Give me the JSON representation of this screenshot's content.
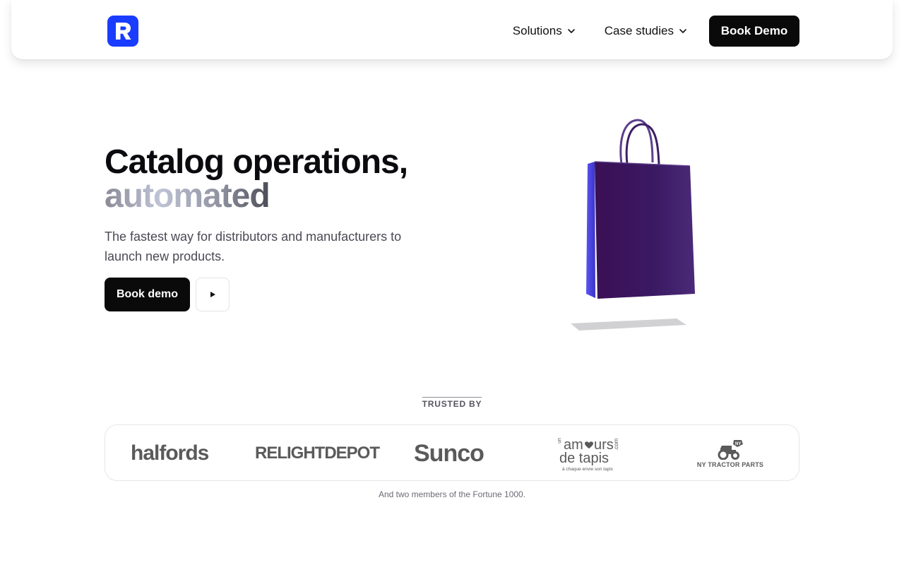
{
  "header": {
    "logo_letter": "R",
    "nav": [
      {
        "label": "Solutions",
        "icon": "chevron-down-icon"
      },
      {
        "label": "Case studies",
        "icon": "chevron-down-icon"
      }
    ],
    "cta_label": "Book Demo"
  },
  "hero": {
    "title_line1": "Catalog operations,",
    "title_line2": "automated",
    "subtitle": "The fastest way for distributors and manufacturers to launch new products.",
    "primary_button": "Book demo",
    "play_icon": "play-icon"
  },
  "trusted": {
    "label": "TRUSTED BY",
    "logos": [
      {
        "name": "halfords",
        "text": "halfords"
      },
      {
        "name": "relightdepot",
        "text": "RELIGHTDEPOT"
      },
      {
        "name": "sunco",
        "text": "Sunco"
      },
      {
        "name": "un-amour-de-tapis",
        "text": "un amour de tapis .com",
        "tagline": "à chaque envie son tapis"
      },
      {
        "name": "ny-tractor-parts",
        "text": "NY TRACTOR PARTS"
      }
    ],
    "note": "And two members of the Fortune 1000."
  },
  "colors": {
    "brand_blue": "#1a3cff",
    "button_dark": "#0a0a0a",
    "bag_purple": "#3d1559",
    "bag_side_blue": "#4b46e6"
  }
}
